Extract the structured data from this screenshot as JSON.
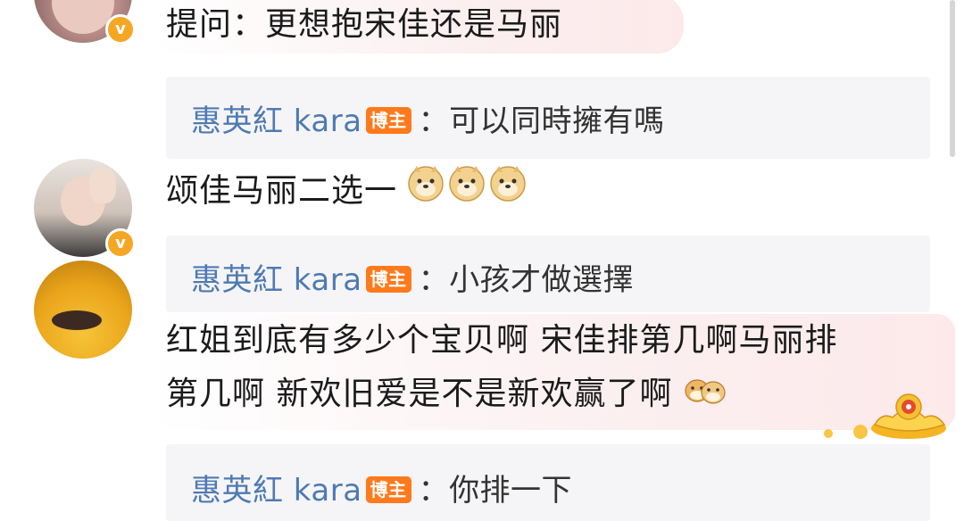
{
  "comments": [
    {
      "text": "提问：更想抱宋佳还是马丽",
      "reply": {
        "author": "惠英紅 kara",
        "badge": "博主",
        "colon": "：",
        "text": "可以同時擁有嗎"
      }
    },
    {
      "text": "颂佳马丽二选一",
      "emoji": "doge-emoji",
      "reply": {
        "author": "惠英紅 kara",
        "badge": "博主",
        "colon": "：",
        "text": "小孩才做選擇"
      }
    },
    {
      "text_line1": "红姐到底有多少个宝贝啊 宋佳排第几啊马丽排",
      "text_line2": "第几啊 新欢旧爱是不是新欢赢了啊",
      "emoji": "shiba-dogs-emoji",
      "decoration": "gold-ingot-sticker",
      "reply": {
        "author": "惠英紅 kara",
        "badge": "博主",
        "colon": "：",
        "text": "你排一下"
      }
    }
  ],
  "verified_badge": "v",
  "colors": {
    "author_blue": "#4f7ab2",
    "blogger_badge": "#ff7a1c",
    "verified_badge": "#f5a623",
    "reply_bg": "#f5f5f7"
  }
}
